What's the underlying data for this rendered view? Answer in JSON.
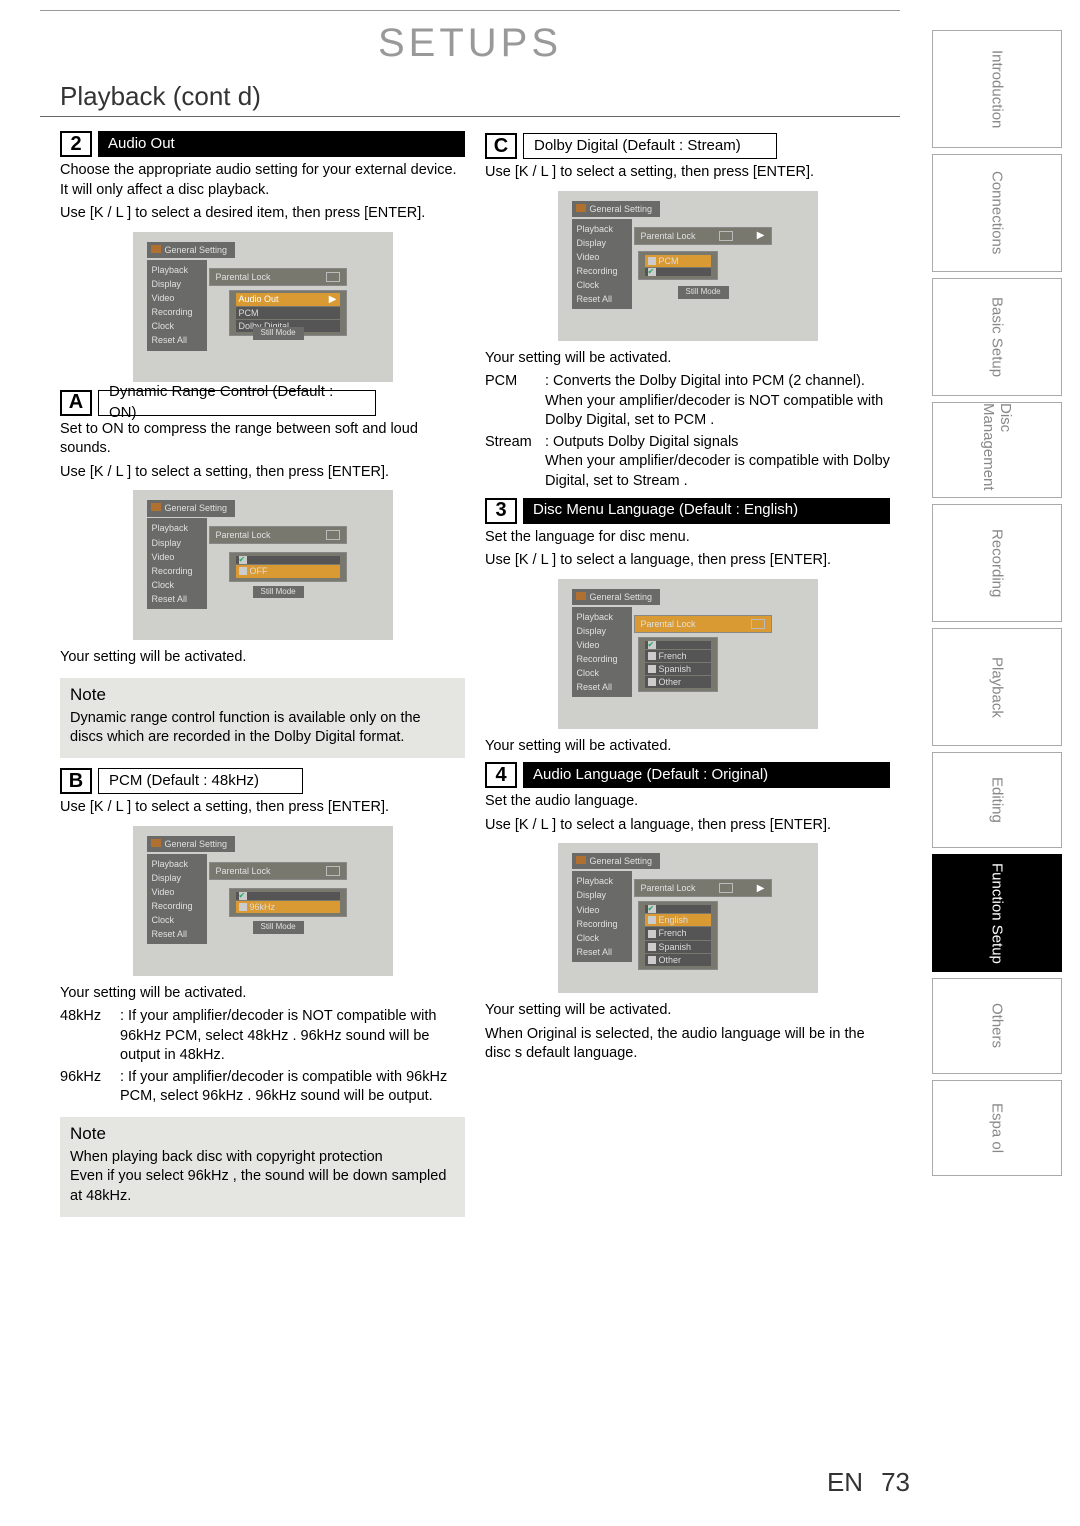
{
  "header": {
    "doc_title": "SETUPS"
  },
  "section": {
    "title": "Playback (cont d)"
  },
  "nav_tabs": [
    "Introduction",
    "Connections",
    "Basic Setup",
    "Disc Management",
    "Recording",
    "Playback",
    "Editing",
    "Function Setup",
    "Others",
    "Espa ol"
  ],
  "footer": {
    "lang": "EN",
    "page": "73"
  },
  "s2": {
    "num": "2",
    "label": "Audio Out",
    "intro1": "Choose the appropriate audio setting for your external device. It will only affect a disc playback.",
    "intro2": "Use [K / L ] to select a desired item, then press [ENTER].",
    "osd": {
      "header": "General Setting",
      "items": [
        "Playback",
        "Display",
        "Video",
        "Recording",
        "Clock",
        "Reset All"
      ],
      "pop": "Parental Lock",
      "sub_hl": "Audio Out",
      "opts": [
        "PCM",
        "Dolby Digital"
      ],
      "foot": "Still Mode"
    }
  },
  "sA": {
    "let": "A",
    "label": "Dynamic Range Control (Default : ON)",
    "p1": "Set to  ON  to compress the range between soft and loud sounds.",
    "p2": "Use [K / L ] to select a setting, then press [ENTER].",
    "osd": {
      "header": "General Setting",
      "items": [
        "Playback",
        "Display",
        "Video",
        "Recording",
        "Clock",
        "Reset All"
      ],
      "pop": "Parental Lock",
      "opt_hl": "OFF",
      "foot": "Still Mode"
    },
    "p3": "Your setting will be activated.",
    "note_t": "Note",
    "note": "Dynamic range control function is available only on the discs which are recorded in the Dolby Digital format."
  },
  "sB": {
    "let": "B",
    "label": "PCM (Default : 48kHz)",
    "p1": "Use [K / L ] to select a setting, then press [ENTER].",
    "osd": {
      "header": "General Setting",
      "items": [
        "Playback",
        "Display",
        "Video",
        "Recording",
        "Clock",
        "Reset All"
      ],
      "pop": "Parental Lock",
      "opt_hl": "96kHz",
      "foot": "Still Mode"
    },
    "p2": "Your setting will be activated.",
    "d1k": "48kHz",
    "d1v": ": If your amplifier/decoder is NOT compatible with 96kHz PCM, select  48kHz . 96kHz sound will be output in 48kHz.",
    "d2k": "96kHz",
    "d2v": ": If your amplifier/decoder is compatible with 96kHz PCM, select  96kHz . 96kHz sound will be output.",
    "note_t": "Note",
    "note": "When playing back disc with copyright protection\n  Even if you select  96kHz , the sound will be down sampled at 48kHz."
  },
  "sC": {
    "let": "C",
    "label": "Dolby Digital (Default : Stream)",
    "p1": "Use [K / L ] to select a setting, then press [ENTER].",
    "osd": {
      "header": "General Setting",
      "items": [
        "Playback",
        "Display",
        "Video",
        "Recording",
        "Clock",
        "Reset All"
      ],
      "pop": "Parental Lock",
      "opt_hl": "PCM",
      "foot": "Still Mode"
    },
    "p2": "Your setting will be activated.",
    "d1k": "PCM",
    "d1v": ": Converts the Dolby Digital into PCM (2 channel). When your amplifier/decoder is NOT compatible with Dolby Digital, set to  PCM .",
    "d2k": "Stream",
    "d2v": ": Outputs Dolby Digital signals\nWhen your amplifier/decoder is compatible with Dolby Digital, set to  Stream ."
  },
  "s3": {
    "num": "3",
    "label": "Disc Menu Language (Default : English)",
    "p1": "Set the language for disc menu.",
    "p2": "Use [K / L ] to select a language, then press [ENTER].",
    "osd": {
      "header": "General Setting",
      "items": [
        "Playback",
        "Display",
        "Video",
        "Recording",
        "Clock",
        "Reset All"
      ],
      "pop": "Parental Lock",
      "opts": [
        "French",
        "Spanish",
        "Other"
      ],
      "foot": ""
    },
    "p3": "Your setting will be activated."
  },
  "s4": {
    "num": "4",
    "label": "Audio Language (Default : Original)",
    "p1": "Set the audio language.",
    "p2": "Use [K / L ] to select a language, then press [ENTER].",
    "osd": {
      "header": "General Setting",
      "items": [
        "Playback",
        "Display",
        "Video",
        "Recording",
        "Clock",
        "Reset All"
      ],
      "pop": "Parental Lock",
      "opts": [
        "English",
        "French",
        "Spanish",
        "Other"
      ],
      "foot": ""
    },
    "p3": "Your setting will be activated.",
    "p4": "  When  Original  is selected, the audio language will be in the disc s default language."
  }
}
